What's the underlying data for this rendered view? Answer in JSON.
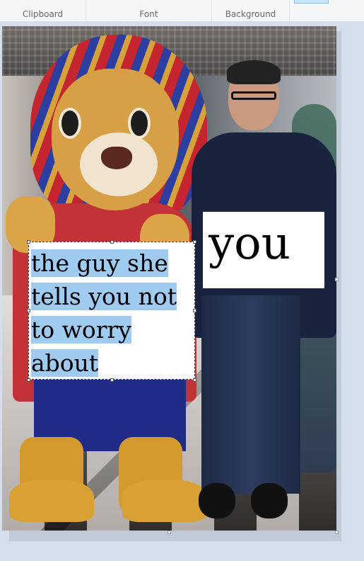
{
  "ribbon": {
    "groups": [
      {
        "label": "Clipboard"
      },
      {
        "label": "Font"
      },
      {
        "label": "Background"
      }
    ]
  },
  "canvas": {
    "text_box_you": {
      "text": "you"
    },
    "text_box_caption": {
      "lines": [
        "the guy she",
        "tells you not",
        "to worry",
        "about"
      ]
    }
  },
  "colors": {
    "selection_highlight": "#9ecbef",
    "ribbon_background": "#f5f6f7",
    "canvas_background": "#d5dfec"
  }
}
